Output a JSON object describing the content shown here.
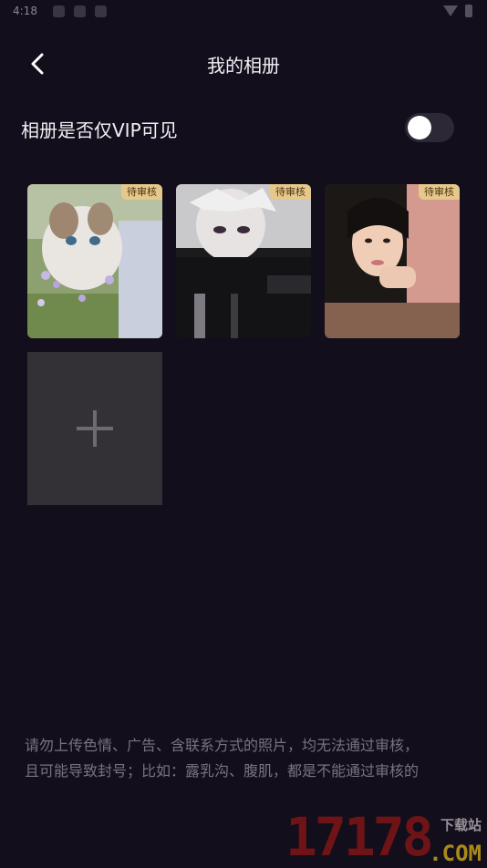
{
  "status_bar": {
    "time": "4:18"
  },
  "header": {
    "title": "我的相册"
  },
  "vip_setting": {
    "label": "相册是否仅VIP可见",
    "enabled": false
  },
  "photos": [
    {
      "badge": "待审核",
      "subject": "cat-in-flowers"
    },
    {
      "badge": "待审核",
      "subject": "anime-character"
    },
    {
      "badge": "待审核",
      "subject": "girl-portrait"
    }
  ],
  "add_photo": {
    "icon": "plus-icon"
  },
  "notice": {
    "line1": "请勿上传色情、广告、含联系方式的照片，均无法通过审核，",
    "line2": "且可能导致封号；比如：露乳沟、腹肌，都是不能通过审核的"
  },
  "watermark": {
    "digits": "17178",
    "text": "下载站",
    "domain": ".COM"
  },
  "colors": {
    "background": "#130e1b",
    "badge": "#e6c88a",
    "toggle_track": "#2c2834"
  }
}
